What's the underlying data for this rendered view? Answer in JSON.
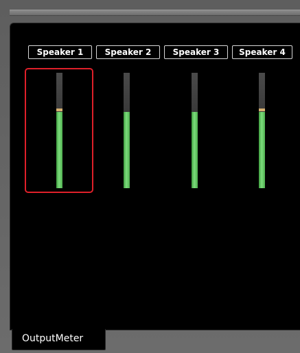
{
  "speakers": [
    {
      "label": "Speaker 1",
      "level": 0.66,
      "peak": 0.69,
      "selected": true
    },
    {
      "label": "Speaker 2",
      "level": 0.66,
      "peak": 0.66,
      "selected": false
    },
    {
      "label": "Speaker 3",
      "level": 0.66,
      "peak": 0.66,
      "selected": false
    },
    {
      "label": "Speaker 4",
      "level": 0.66,
      "peak": 0.69,
      "selected": false
    }
  ],
  "tabs": [
    {
      "label": "OutputMeter"
    }
  ],
  "colors": {
    "meter_fill": "#5cc85c",
    "peak_marker": "#d7b070",
    "selection": "#e0202a",
    "panel_background": "#000000"
  }
}
